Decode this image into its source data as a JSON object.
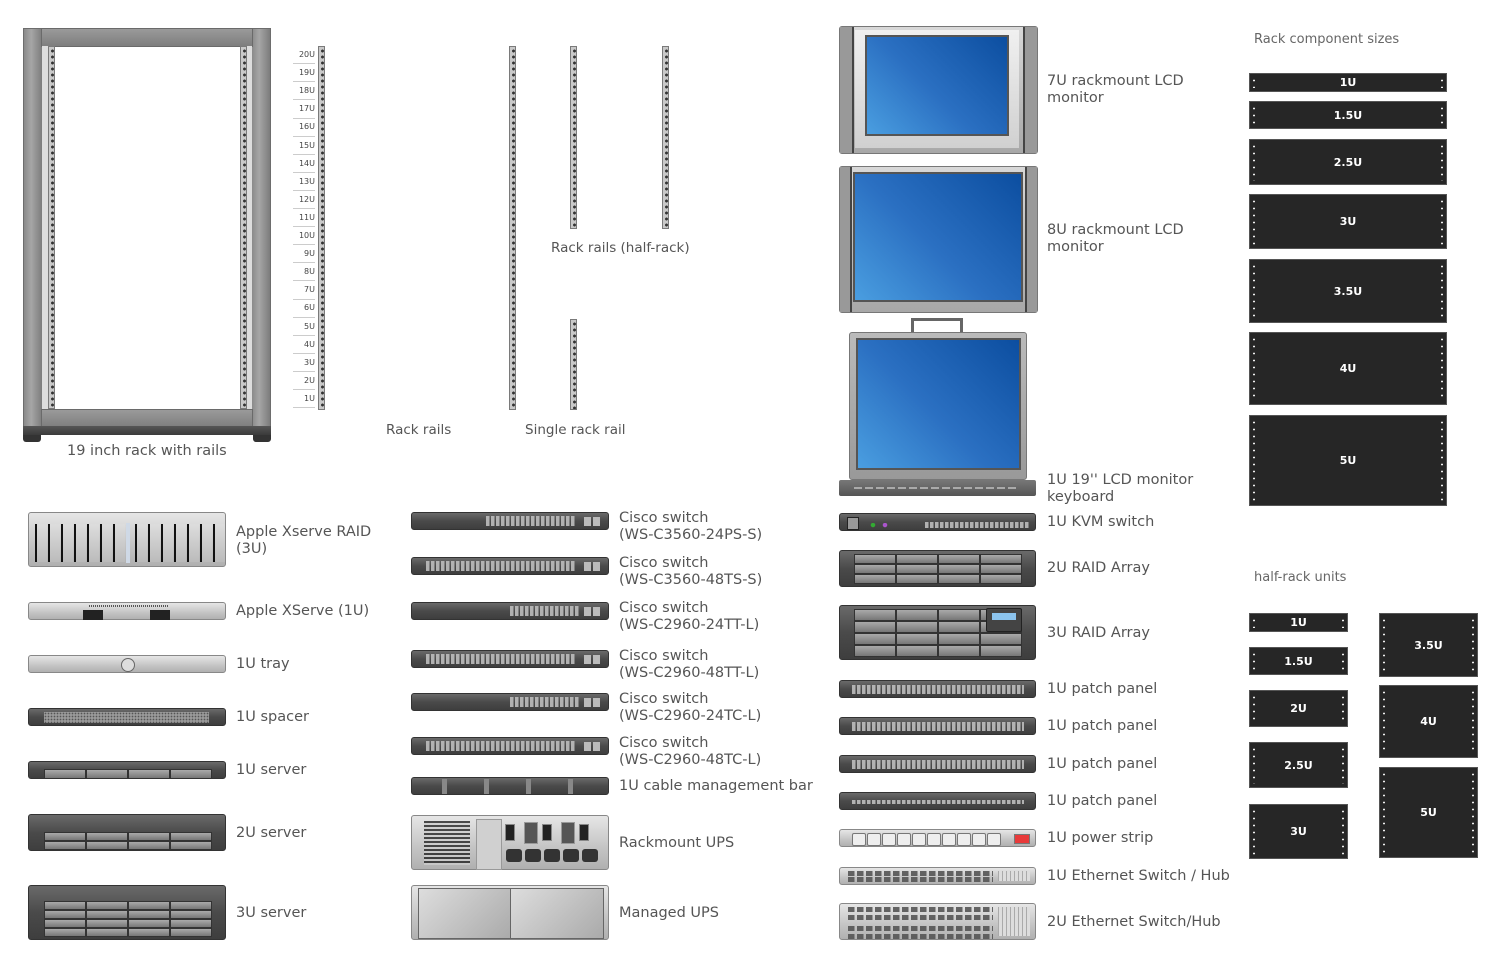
{
  "rack": {
    "label": "19 inch rack with rails",
    "unit_labels": [
      "20U",
      "19U",
      "18U",
      "17U",
      "16U",
      "15U",
      "14U",
      "13U",
      "12U",
      "11U",
      "10U",
      "9U",
      "8U",
      "7U",
      "6U",
      "5U",
      "4U",
      "3U",
      "2U",
      "1U"
    ]
  },
  "rails": {
    "rack_rails_label": "Rack rails",
    "single_rail_label": "Single rack rail",
    "half_rack_label": "Rack rails (half-rack)"
  },
  "left_column": [
    {
      "label": "Apple Xserve RAID\n(3U)",
      "icon": "apple-xserve-raid-icon"
    },
    {
      "label": "Apple XServe (1U)",
      "icon": "apple-xserve-icon"
    },
    {
      "label": "1U tray",
      "icon": "tray-icon"
    },
    {
      "label": "1U spacer",
      "icon": "spacer-icon"
    },
    {
      "label": "1U server",
      "icon": "server-1u-icon"
    },
    {
      "label": "2U server",
      "icon": "server-2u-icon"
    },
    {
      "label": "3U server",
      "icon": "server-3u-icon"
    }
  ],
  "middle_column": [
    {
      "label": "Cisco switch\n(WS-C3560-24PS-S)",
      "icon": "cisco-switch-icon"
    },
    {
      "label": "Cisco switch\n(WS-C3560-48TS-S)",
      "icon": "cisco-switch-icon"
    },
    {
      "label": "Cisco switch\n(WS-C2960-24TT-L)",
      "icon": "cisco-switch-icon"
    },
    {
      "label": "Cisco switch\n(WS-C2960-48TT-L)",
      "icon": "cisco-switch-icon"
    },
    {
      "label": "Cisco switch\n(WS-C2960-24TC-L)",
      "icon": "cisco-switch-icon"
    },
    {
      "label": "Cisco switch\n(WS-C2960-48TC-L)",
      "icon": "cisco-switch-icon"
    },
    {
      "label": "1U cable management bar",
      "icon": "cable-management-bar-icon"
    },
    {
      "label": "Rackmount UPS",
      "icon": "rackmount-ups-icon"
    },
    {
      "label": "Managed UPS",
      "icon": "managed-ups-icon"
    }
  ],
  "monitors": [
    {
      "label": "7U rackmount LCD\nmonitor",
      "icon": "lcd-monitor-icon"
    },
    {
      "label": "8U rackmount LCD\nmonitor",
      "icon": "lcd-monitor-icon"
    },
    {
      "label": "1U 19'' LCD monitor\nkeyboard",
      "icon": "lcd-monitor-keyboard-icon"
    }
  ],
  "right_column": [
    {
      "label": "1U KVM switch",
      "icon": "kvm-switch-icon"
    },
    {
      "label": "2U RAID Array",
      "icon": "raid-array-icon"
    },
    {
      "label": "3U RAID Array",
      "icon": "raid-array-icon"
    },
    {
      "label": "1U patch panel",
      "icon": "patch-panel-icon"
    },
    {
      "label": "1U patch panel",
      "icon": "patch-panel-icon"
    },
    {
      "label": "1U patch panel",
      "icon": "patch-panel-icon"
    },
    {
      "label": "1U patch panel",
      "icon": "patch-panel-icon"
    },
    {
      "label": "1U power strip",
      "icon": "power-strip-icon"
    },
    {
      "label": "1U Ethernet Switch / Hub",
      "icon": "ethernet-switch-icon"
    },
    {
      "label": "2U Ethernet Switch/Hub",
      "icon": "ethernet-switch-icon"
    }
  ],
  "sizes": {
    "title": "Rack component sizes",
    "blocks": [
      "1U",
      "1.5U",
      "2.5U",
      "3U",
      "3.5U",
      "4U",
      "5U"
    ]
  },
  "half_rack": {
    "title": "half-rack units",
    "left_blocks": [
      "1U",
      "1.5U",
      "2U",
      "2.5U",
      "3U"
    ],
    "right_blocks": [
      "3.5U",
      "4U",
      "5U"
    ]
  },
  "colors": {
    "screen_blue": "#2b70c2",
    "block_dark": "#262626",
    "power_switch_red": "#e83a3a"
  }
}
